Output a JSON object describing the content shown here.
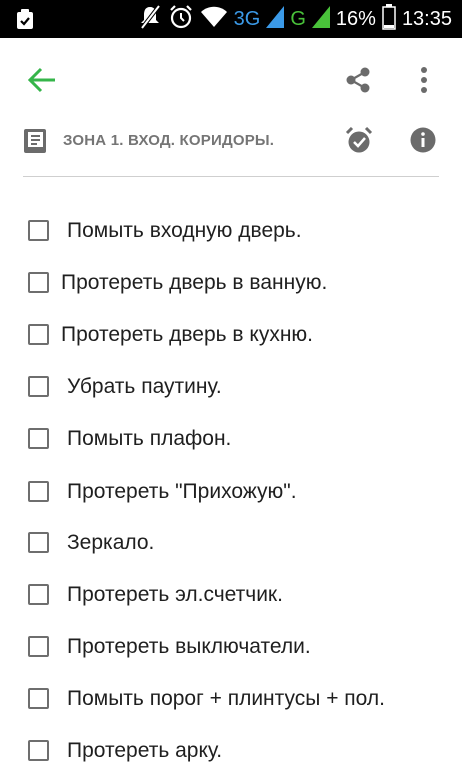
{
  "status_bar": {
    "network_1": "3G",
    "network_2": "G",
    "battery": "16%",
    "time": "13:35"
  },
  "toolbar": {
    "back_icon": "arrow-back-icon",
    "share_icon": "share-icon",
    "more_icon": "more-vert-icon",
    "accent_color": "#35b54a"
  },
  "zone": {
    "title": "ЗОНА 1. ВХОД. КОРИДОРЫ.",
    "book_icon": "book-icon",
    "alarm_icon": "alarm-check-icon",
    "info_icon": "info-icon"
  },
  "checklist": [
    {
      "label": "Помыть входную дверь.",
      "checked": false
    },
    {
      "label": "Протереть дверь в ванную.",
      "checked": false
    },
    {
      "label": "Протереть дверь в кухню.",
      "checked": false
    },
    {
      "label": "Убрать паутину.",
      "checked": false
    },
    {
      "label": "Помыть плафон.",
      "checked": false
    },
    {
      "label": "Протереть \"Прихожую\".",
      "checked": false
    },
    {
      "label": "Зеркало.",
      "checked": false
    },
    {
      "label": "Протереть эл.счетчик.",
      "checked": false
    },
    {
      "label": "Протереть выключатели.",
      "checked": false
    },
    {
      "label": "Помыть порог + плинтусы + пол.",
      "checked": false
    },
    {
      "label": "Протереть арку.",
      "checked": false
    }
  ]
}
